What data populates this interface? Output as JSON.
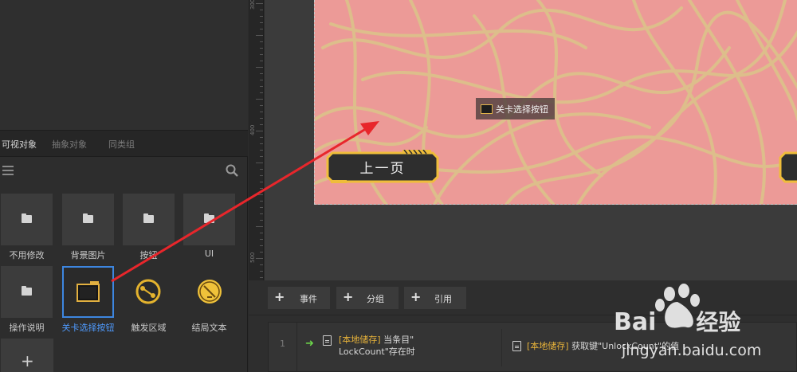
{
  "left_panel": {
    "tabs": [
      {
        "label": "可视对象",
        "active": true
      },
      {
        "label": "抽象对象",
        "active": false
      },
      {
        "label": "同类组",
        "active": false
      }
    ],
    "assets": [
      {
        "label": "不用修改",
        "kind": "folder"
      },
      {
        "label": "背景图片",
        "kind": "folder"
      },
      {
        "label": "按钮",
        "kind": "folder"
      },
      {
        "label": "UI",
        "kind": "folder"
      },
      {
        "label": "操作说明",
        "kind": "folder"
      },
      {
        "label": "关卡选择按钮",
        "kind": "sprite",
        "selected": true
      },
      {
        "label": "触发区域",
        "kind": "trigger"
      },
      {
        "label": "结局文本",
        "kind": "text"
      }
    ]
  },
  "ruler": {
    "labels": [
      "300",
      "400",
      "500",
      "600"
    ]
  },
  "canvas": {
    "stage_color": "#ec9a97",
    "line_color": "#d9c488",
    "tooltip_label": "关卡选择按钮",
    "prev_button_label": "上一页"
  },
  "bottom": {
    "buttons": [
      {
        "label": "事件"
      },
      {
        "label": "分组"
      },
      {
        "label": "引用"
      }
    ],
    "event_row": {
      "number": "1",
      "condition_tag": "[本地储存]",
      "condition_text_1": "当条目\"",
      "condition_text_2": "LockCount\"存在时",
      "action_tag": "[本地储存]",
      "action_text": "获取键\"UnlockCount\"的值"
    }
  },
  "watermark": {
    "brand": "Bai",
    "brand_suffix": "经验",
    "url": "jingyan.baidu.com"
  },
  "colors": {
    "accent": "#3d86e0",
    "highlight": "#e8b33a",
    "arrow": "#e8262b"
  }
}
